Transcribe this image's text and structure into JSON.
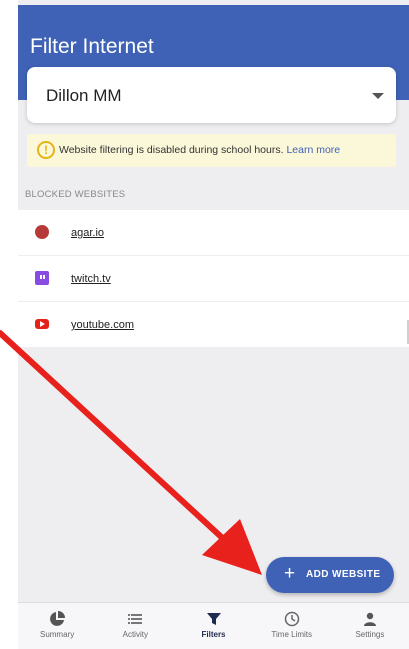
{
  "header": {
    "title": "Filter Internet"
  },
  "profile_select": {
    "value": "Dillon MM"
  },
  "notice": {
    "text": "Website filtering is disabled during school hours.",
    "link": "Learn more"
  },
  "blocked": {
    "section_label": "BLOCKED WEBSITES",
    "items": [
      {
        "label": "agar.io",
        "icon": "red-dot-icon"
      },
      {
        "label": "twitch.tv",
        "icon": "twitch-icon"
      },
      {
        "label": "youtube.com",
        "icon": "youtube-icon"
      }
    ]
  },
  "fab": {
    "label": "ADD WEBSITE",
    "icon": "plus-icon"
  },
  "nav": {
    "items": [
      {
        "label": "Summary",
        "icon": "pie-chart-icon"
      },
      {
        "label": "Activity",
        "icon": "list-icon"
      },
      {
        "label": "Filters",
        "icon": "filter-icon",
        "active": true
      },
      {
        "label": "Time Limits",
        "icon": "clock-icon"
      },
      {
        "label": "Settings",
        "icon": "person-icon"
      }
    ]
  },
  "colors": {
    "primary": "#3f62b6",
    "notice_bg": "#fbf7d9",
    "notice_icon": "#e7b417",
    "annotation_arrow": "#e8211d"
  }
}
